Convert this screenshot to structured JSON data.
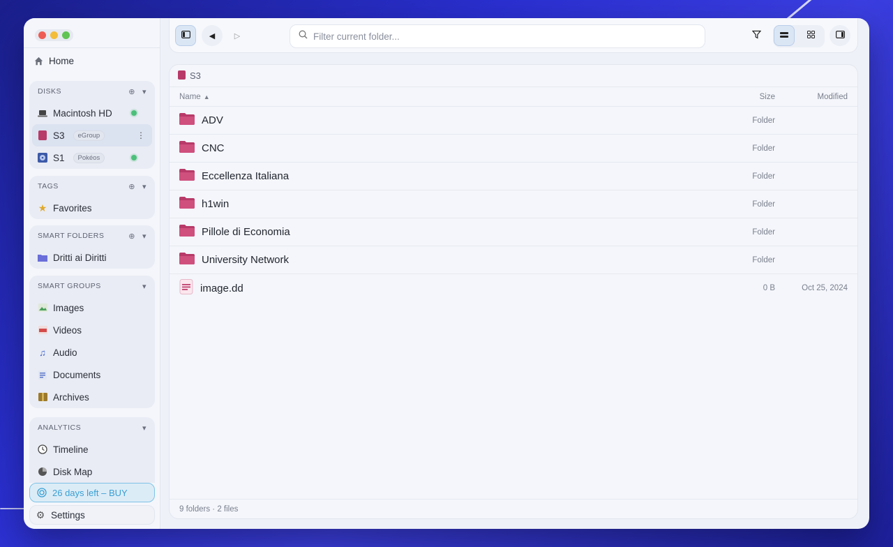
{
  "sidebar": {
    "home": "Home",
    "disks": {
      "title": "DISKS",
      "items": [
        {
          "label": "Macintosh HD",
          "tag": "",
          "icon": "laptop-icon"
        },
        {
          "label": "S3",
          "tag": "eGroup",
          "icon": "external-disk-icon"
        },
        {
          "label": "S1",
          "tag": "Pokéos",
          "icon": "disk-image-icon"
        }
      ]
    },
    "tags": {
      "title": "TAGS",
      "items": [
        {
          "label": "Favorites",
          "icon": "star-icon"
        }
      ]
    },
    "smart_folders": {
      "title": "SMART FOLDERS",
      "items": [
        {
          "label": "Dritti ai Diritti",
          "icon": "folder-icon"
        }
      ]
    },
    "smart_groups": {
      "title": "SMART GROUPS",
      "items": [
        {
          "label": "Images",
          "icon": "image-icon"
        },
        {
          "label": "Videos",
          "icon": "video-icon"
        },
        {
          "label": "Audio",
          "icon": "audio-icon"
        },
        {
          "label": "Documents",
          "icon": "document-icon"
        },
        {
          "label": "Archives",
          "icon": "archive-icon"
        }
      ]
    },
    "analytics": {
      "title": "ANALYTICS",
      "items": [
        {
          "label": "Timeline",
          "icon": "clock-icon"
        },
        {
          "label": "Disk Map",
          "icon": "pie-icon"
        }
      ]
    },
    "trial": "26 days left – BUY",
    "settings": "Settings"
  },
  "toolbar": {
    "search_placeholder": "Filter current folder..."
  },
  "browser": {
    "breadcrumb": "S3",
    "columns": {
      "name": "Name",
      "size": "Size",
      "modified": "Modified"
    },
    "rows": [
      {
        "name": "ADV",
        "size": "Folder",
        "modified": "",
        "type": "folder"
      },
      {
        "name": "CNC",
        "size": "Folder",
        "modified": "",
        "type": "folder"
      },
      {
        "name": "Eccellenza Italiana",
        "size": "Folder",
        "modified": "",
        "type": "folder"
      },
      {
        "name": "h1win",
        "size": "Folder",
        "modified": "",
        "type": "folder"
      },
      {
        "name": "Pillole di Economia",
        "size": "Folder",
        "modified": "",
        "type": "folder"
      },
      {
        "name": "University Network",
        "size": "Folder",
        "modified": "",
        "type": "folder"
      },
      {
        "name": "image.dd",
        "size": "0 B",
        "modified": "Oct 25, 2024",
        "type": "file"
      }
    ],
    "footer": "9 folders · 2 files"
  },
  "colors": {
    "folder": "#c0406e",
    "accent": "#3a9fd3"
  }
}
